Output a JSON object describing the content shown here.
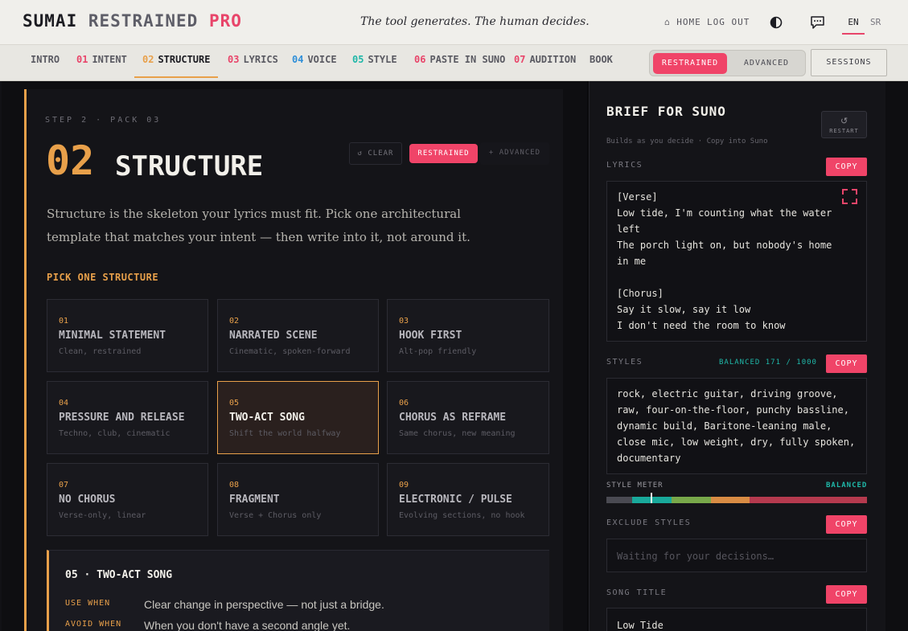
{
  "header": {
    "brand_part1": "SUMAI",
    "brand_part2": "RESTRAINED",
    "brand_part3": "PRO",
    "tagline": "The tool generates. The human decides.",
    "home": "⌂ HOME",
    "logout": "LOG OUT",
    "lang_en": "EN",
    "lang_sr": "SR",
    "icons": [
      "theme-toggle-icon",
      "chat-icon"
    ]
  },
  "nav": {
    "items": [
      {
        "num": "",
        "label": "INTRO",
        "num_color": ""
      },
      {
        "num": "01",
        "label": "INTENT",
        "num_color": "#e8456a"
      },
      {
        "num": "02",
        "label": "STRUCTURE",
        "num_color": "#e8a04a"
      },
      {
        "num": "03",
        "label": "LYRICS",
        "num_color": "#e8456a"
      },
      {
        "num": "04",
        "label": "VOICE",
        "num_color": "#2f8fd8"
      },
      {
        "num": "05",
        "label": "STYLE",
        "num_color": "#1fb7a8"
      },
      {
        "num": "06",
        "label": "PASTE IN SUNO",
        "num_color": "#e8456a"
      },
      {
        "num": "07",
        "label": "AUDITION",
        "num_color": "#e8456a"
      },
      {
        "num": "",
        "label": "BOOK",
        "num_color": ""
      }
    ],
    "active_index": 2,
    "mode_restrained": "RESTRAINED",
    "mode_advanced": "ADVANCED",
    "sessions": "SESSIONS"
  },
  "main": {
    "step_label": "STEP 2 · PACK 03",
    "big_num": "02",
    "title": "STRUCTURE",
    "clear": "↺ CLEAR",
    "restrained": "RESTRAINED",
    "advanced": "+ ADVANCED",
    "description": "Structure is the skeleton your lyrics must fit. Pick one architectural template that matches your intent — then write into it, not around it.",
    "pick_label": "PICK ONE STRUCTURE",
    "cards": [
      {
        "num": "01",
        "title": "MINIMAL STATEMENT",
        "sub": "Clean, restrained",
        "selected": false
      },
      {
        "num": "02",
        "title": "NARRATED SCENE",
        "sub": "Cinematic, spoken-forward",
        "selected": false
      },
      {
        "num": "03",
        "title": "HOOK FIRST",
        "sub": "Alt-pop friendly",
        "selected": false
      },
      {
        "num": "04",
        "title": "PRESSURE AND RELEASE",
        "sub": "Techno, club, cinematic",
        "selected": false
      },
      {
        "num": "05",
        "title": "TWO-ACT SONG",
        "sub": "Shift the world halfway",
        "selected": true
      },
      {
        "num": "06",
        "title": "CHORUS AS REFRAME",
        "sub": "Same chorus, new meaning",
        "selected": false
      },
      {
        "num": "07",
        "title": "NO CHORUS",
        "sub": "Verse-only, linear",
        "selected": false
      },
      {
        "num": "08",
        "title": "FRAGMENT",
        "sub": "Verse + Chorus only",
        "selected": false
      },
      {
        "num": "09",
        "title": "ELECTRONIC / PULSE",
        "sub": "Evolving sections, no hook",
        "selected": false
      }
    ],
    "detail": {
      "title": "05 · TWO-ACT SONG",
      "use_label": "USE WHEN",
      "use_value": "Clear change in perspective — not just a bridge.",
      "avoid_label": "AVOID WHEN",
      "avoid_value": "When you don't have a second angle yet."
    }
  },
  "side": {
    "title": "BRIEF FOR SUNO",
    "subtitle": "Builds as you decide · Copy into Suno",
    "restart": "RESTART",
    "lyrics_label": "LYRICS",
    "copy": "COPY",
    "lyrics_lines": [
      "[Verse]",
      "Low tide, I'm counting what the water",
      "left",
      "The porch light on, but nobody's home",
      "in me",
      "",
      "[Chorus]",
      "Say it slow, say it low",
      "I don't need the room to know"
    ],
    "styles_label": "STYLES",
    "styles_status": "BALANCED 171 / 1000",
    "styles_text": "rock, electric guitar, driving groove, raw, four-on-the-floor, punchy bassline, dynamic build, Baritone-leaning male, close mic, low weight, dry, fully spoken, documentary",
    "meter_label": "STYLE METER",
    "meter_status": "BALANCED",
    "meter_segments": [
      {
        "color": "#4a4a52",
        "fraction": 0.1
      },
      {
        "color": "#19a99b",
        "fraction": 0.15
      },
      {
        "color": "#78a84a",
        "fraction": 0.15
      },
      {
        "color": "#d98c44",
        "fraction": 0.15
      },
      {
        "color": "#b53a4e",
        "fraction": 0.45
      }
    ],
    "meter_value_fraction": 0.17,
    "exclude_label": "EXCLUDE STYLES",
    "exclude_placeholder": "Waiting for your decisions…",
    "song_title_label": "SONG TITLE",
    "song_title": "Low Tide"
  }
}
